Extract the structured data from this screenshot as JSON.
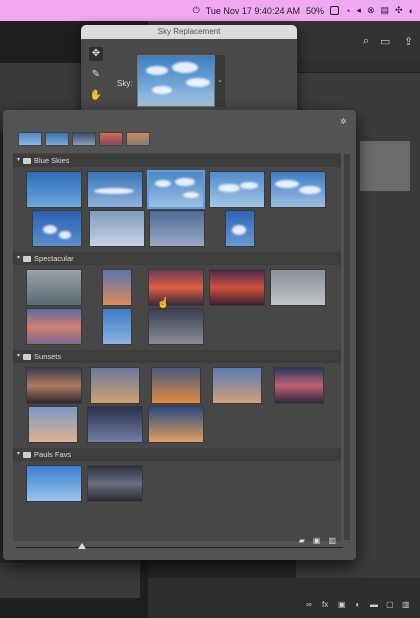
{
  "menubar": {
    "date_time": "Tue Nov 17  9:40:24 AM",
    "battery": "50%",
    "icons": [
      "control-icon",
      "wifi-icon",
      "volume-icon",
      "creative-cloud-icon",
      "screen-icon",
      "siri-icon"
    ]
  },
  "dialog": {
    "title": "Sky Replacement",
    "sky_label": "Sky:",
    "tools": [
      "move-sky-tool-icon",
      "sky-brush-icon",
      "hand-tool-icon",
      "zoom-tool-icon"
    ]
  },
  "panel": {
    "groups": [
      {
        "name": "Blue Skies",
        "count": 9
      },
      {
        "name": "Spectacular",
        "count": 8
      },
      {
        "name": "Sunsets",
        "count": 8
      },
      {
        "name": "Pauls Favs",
        "count": 2
      }
    ]
  },
  "colors": {
    "menubar_bg": "#f0a8f0",
    "panel_bg": "#535353",
    "selection": "#5aa0e0"
  }
}
